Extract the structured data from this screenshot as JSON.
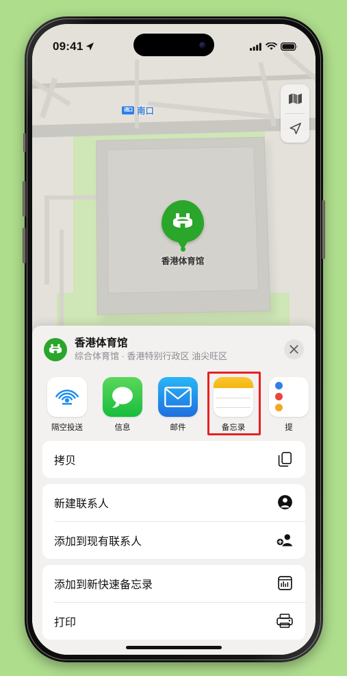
{
  "status_bar": {
    "time": "09:41",
    "location_arrow": "location-arrow-icon",
    "cellular": "cellular-bars-icon",
    "wifi": "wifi-icon",
    "battery": "battery-icon"
  },
  "map": {
    "transit_label": {
      "badge": "进口",
      "name": "南口"
    },
    "poi": {
      "label": "香港体育馆",
      "pin_color": "#2aa62a",
      "glyph": "stadium-icon"
    },
    "controls": {
      "map_mode": "map-layers-icon",
      "locate": "locate-arrow-icon"
    }
  },
  "share_sheet": {
    "poi_icon": "stadium-icon",
    "title": "香港体育馆",
    "subtitle": "综合体育馆 · 香港特别行政区 油尖旺区",
    "close_label": "close-icon",
    "apps": [
      {
        "label": "隔空投送",
        "icon": "airdrop-icon",
        "highlighted": false
      },
      {
        "label": "信息",
        "icon": "messages-icon",
        "highlighted": false
      },
      {
        "label": "邮件",
        "icon": "mail-icon",
        "highlighted": false
      },
      {
        "label": "备忘录",
        "icon": "notes-icon",
        "highlighted": true
      },
      {
        "label": "提",
        "icon": "reminders-icon",
        "highlighted": false
      }
    ],
    "actions": [
      {
        "label": "拷贝",
        "icon": "copy-icon"
      },
      {
        "label": "新建联系人",
        "icon": "new-contact-icon"
      },
      {
        "label": "添加到现有联系人",
        "icon": "add-to-contact-icon"
      },
      {
        "label": "添加到新快速备忘录",
        "icon": "quick-note-icon"
      },
      {
        "label": "打印",
        "icon": "printer-icon"
      }
    ]
  },
  "colors": {
    "background": "#aedd8c",
    "accent_green": "#2aa62a",
    "highlight_red": "#e8201f",
    "transit_blue": "#3d7fd1"
  }
}
